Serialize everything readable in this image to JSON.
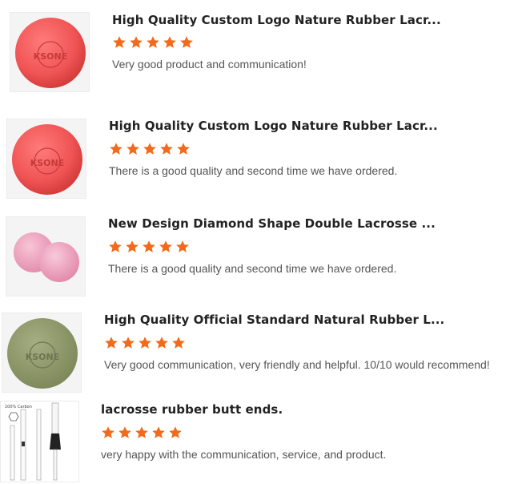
{
  "colors": {
    "star": "#f26a1b",
    "title": "#222222",
    "comment": "#555555",
    "red_ball": "#f25a5a",
    "pink_ball": "#f1a7c0",
    "green_ball": "#8e9a6b"
  },
  "reviews": [
    {
      "title": "High Quality Custom Logo Nature Rubber Lacr...",
      "rating": 5,
      "comment": "Very good product and communication!",
      "image": "red-lacrosse-ball",
      "logo_text": "KSONE"
    },
    {
      "title": "High Quality Custom Logo Nature Rubber Lacr...",
      "rating": 5,
      "comment": "There is a good quality and second time we have ordered.",
      "image": "red-lacrosse-ball",
      "logo_text": "KSONE"
    },
    {
      "title": "New Design Diamond Shape Double Lacrosse ...",
      "rating": 5,
      "comment": "There is a good quality and second time we have ordered.",
      "image": "pink-double-ball"
    },
    {
      "title": "High Quality Official Standard Natural Rubber L...",
      "rating": 5,
      "comment": "Very good communication, very friendly and helpful. 10/10 would recommend!",
      "image": "green-lacrosse-ball",
      "logo_text": "KSONE"
    },
    {
      "title": "lacrosse rubber butt ends.",
      "rating": 5,
      "comment": "very happy with the communication, service, and product.",
      "image": "lacrosse-shaft-butt-ends",
      "image_label": "100% Carbon"
    }
  ]
}
